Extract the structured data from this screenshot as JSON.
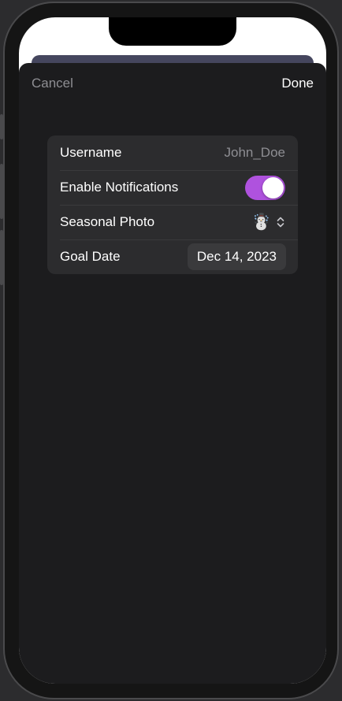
{
  "nav": {
    "cancel_label": "Cancel",
    "done_label": "Done"
  },
  "form": {
    "rows": [
      {
        "label": "Username",
        "value": "John_Doe"
      },
      {
        "label": "Enable Notifications",
        "toggle_on": true
      },
      {
        "label": "Seasonal Photo",
        "value": "☃️"
      },
      {
        "label": "Goal Date",
        "value": "Dec 14, 2023"
      }
    ]
  },
  "colors": {
    "accent_toggle": "#af52de",
    "sheet_background": "#1c1c1e",
    "group_background": "#2c2c2e"
  },
  "icons": {
    "seasonal_photo": "snowman-icon",
    "picker_indicator": "chevron-up-down-icon"
  }
}
